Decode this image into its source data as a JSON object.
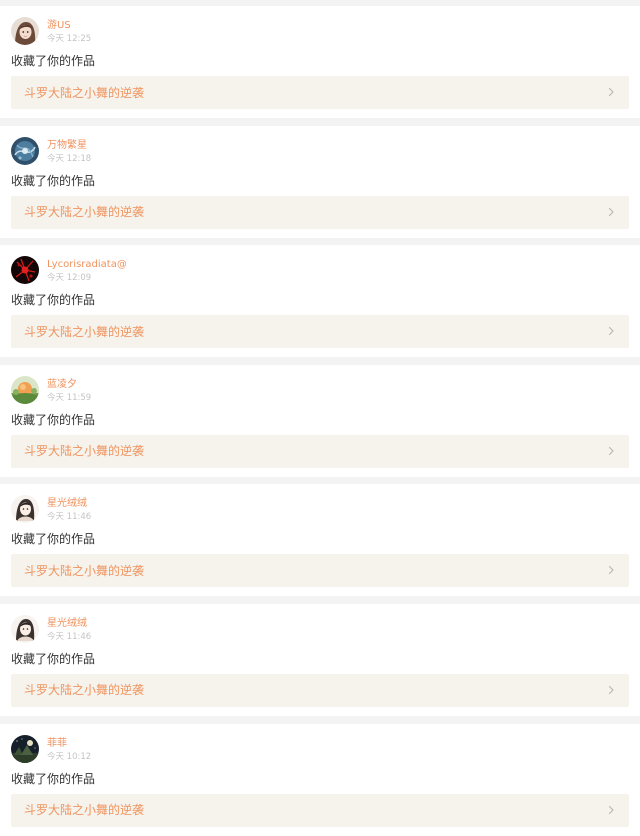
{
  "notifications": [
    {
      "user": "游US",
      "time": "今天 12:25",
      "action": "收藏了你的作品",
      "work_title": "斗罗大陆之小舞的逆袭",
      "avatar": "portrait-girl-brown-hair"
    },
    {
      "user": "万物繁星",
      "time": "今天 12:18",
      "action": "收藏了你的作品",
      "work_title": "斗罗大陆之小舞的逆袭",
      "avatar": "blue-swirl-art"
    },
    {
      "user": "Lycorisradiata@",
      "time": "今天 12:09",
      "action": "收藏了你的作品",
      "work_title": "斗罗大陆之小舞的逆袭",
      "avatar": "red-spider-lily"
    },
    {
      "user": "蓝凌夕",
      "time": "今天 11:59",
      "action": "收藏了你的作品",
      "work_title": "斗罗大陆之小舞的逆袭",
      "avatar": "orange-garden"
    },
    {
      "user": "星光绒绒",
      "time": "今天 11:46",
      "action": "收藏了你的作品",
      "work_title": "斗罗大陆之小舞的逆袭",
      "avatar": "anime-girl-sketch"
    },
    {
      "user": "星光绒绒",
      "time": "今天 11:46",
      "action": "收藏了你的作品",
      "work_title": "斗罗大陆之小舞的逆袭",
      "avatar": "anime-girl-sketch"
    },
    {
      "user": "菲菲",
      "time": "今天 10:12",
      "action": "收藏了你的作品",
      "work_title": "斗罗大陆之小舞的逆袭",
      "avatar": "dark-night-scene"
    }
  ],
  "colors": {
    "username": "#f0935f",
    "work_title": "#f0935f",
    "link_background": "#f5f3ec",
    "time": "#c4c4c4",
    "action": "#333333",
    "page_background": "#f3f3f3"
  }
}
